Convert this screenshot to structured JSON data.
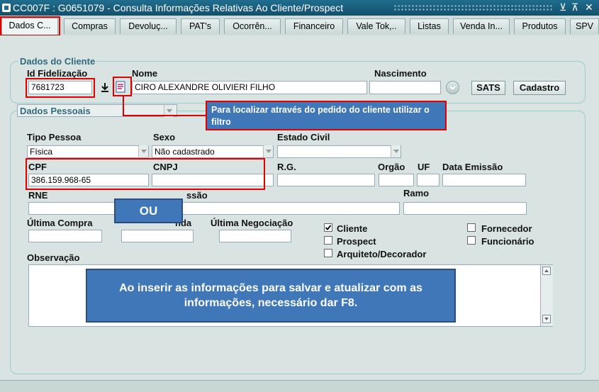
{
  "window": {
    "title": "CC007F : G0651079 - Consulta Informações Relativas Ao Cliente/Prospect",
    "controls": [
      "⊻",
      "⊼",
      "✕"
    ]
  },
  "tabs": [
    "Dados C...",
    "Compras",
    "Devoluç...",
    "PAT's",
    "Ocorrên...",
    "Financeiro",
    "Vale Tok,..",
    "Listas",
    "Venda In...",
    "Produtos",
    "SPV"
  ],
  "dados_cliente": {
    "group_title": "Dados do Cliente",
    "id_label": "Id Fidelização",
    "id_value": "7681723",
    "nome_label": "Nome",
    "nome_value": "CIRO ALEXANDRE OLIVIERI FILHO",
    "nascimento_label": "Nascimento",
    "nascimento_value": "",
    "sats_button": "SATS",
    "cadastro_button": "Cadastro"
  },
  "dados_pessoais": {
    "dropdown_label": "Dados Pessoais",
    "tipo_pessoa_label": "Tipo Pessoa",
    "tipo_pessoa_value": "Física",
    "sexo_label": "Sexo",
    "sexo_value": "Não cadastrado",
    "estado_civil_label": "Estado Civil",
    "estado_civil_value": "",
    "cpf_label": "CPF",
    "cpf_value": "386.159.968-65",
    "cnpj_label": "CNPJ",
    "cnpj_value": "",
    "rg_label": "R.G.",
    "orgao_label": "Orgão",
    "uf_label": "UF",
    "data_emissao_label": "Data Emissão",
    "rne_label": "RNE",
    "profissao_label_visible": "ssão",
    "ramo_label": "Ramo",
    "ultima_compra_label": "Última Compra",
    "ultima_venda_label_visible": "nda",
    "ultima_negociacao_label": "Última Negociação",
    "observacao_label": "Observação"
  },
  "checkboxes": [
    {
      "label": "Cliente",
      "checked": true
    },
    {
      "label": "Prospect",
      "checked": false
    },
    {
      "label": "Arquiteto/Decorador",
      "checked": false
    },
    {
      "label": "Fornecedor",
      "checked": false
    },
    {
      "label": "Funcionário",
      "checked": false
    }
  ],
  "annotations": {
    "filter_callout": "Para localizar através do pedido do cliente utilizar o filtro",
    "ou_label": "OU",
    "f8_callout": "Ao inserir as informações para salvar e atualizar com as informações, necessário dar F8."
  },
  "colors": {
    "titlebar": "#1f6d8e",
    "callout": "#3f77b8",
    "highlight": "#e00000"
  }
}
